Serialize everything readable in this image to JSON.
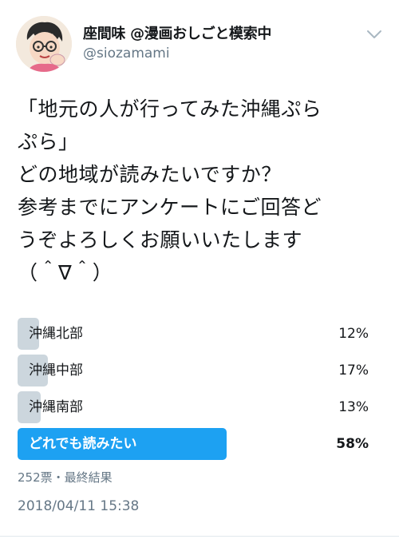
{
  "user": {
    "display_name": "座間味 @漫画おしごと模索中",
    "handle": "@siozamami",
    "avatar_icon": "cartoon-avatar"
  },
  "menu_icon": "chevron-down-icon",
  "tweet_text": "「地元の人が行ってみた沖縄ぷら\nぷら」\nどの地域が読みたいですか？\n参考までにアンケートにご回答ど\nうぞよろしくお願いいたします\n（＾∇＾）",
  "poll": {
    "choices": [
      {
        "label": "沖縄北部",
        "percent_label": "12%",
        "percent": 12
      },
      {
        "label": "沖縄中部",
        "percent_label": "17%",
        "percent": 17
      },
      {
        "label": "沖縄南部",
        "percent_label": "13%",
        "percent": 13
      },
      {
        "label": "どれでも読みたい",
        "percent_label": "58%",
        "percent": 58,
        "winner": true
      }
    ],
    "meta": "252票・最終結果"
  },
  "timestamp": "2018/04/11 15:38",
  "colors": {
    "accent": "#1da1f2",
    "bar": "#ccd6dd",
    "secondary_text": "#657786"
  }
}
